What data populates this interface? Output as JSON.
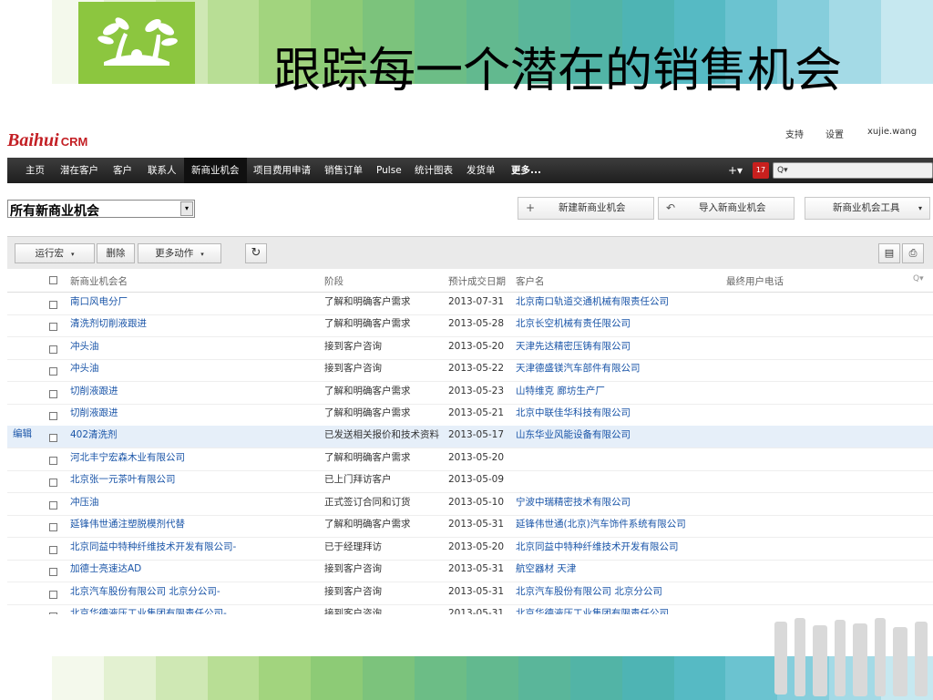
{
  "slide": {
    "title": "跟踪每一个潜在的销售机会",
    "colors": {
      "accent_green": "#8cc63f",
      "accent_teal": "#4fb8c4"
    }
  },
  "brand": {
    "name": "Baihui",
    "suffix": "CRM"
  },
  "util_links": {
    "support": "支持",
    "settings": "设置",
    "user": "xujie.wang"
  },
  "nav": {
    "items": [
      "主页",
      "潜在客户",
      "客户",
      "联系人",
      "新商业机会",
      "项目费用申请",
      "销售订单",
      "Pulse",
      "统计图表",
      "发货单",
      "更多..."
    ],
    "active": "新商业机会",
    "plus": "+▾",
    "calendar": "17",
    "search": "Q▾"
  },
  "view_select": {
    "value": "所有新商业机会",
    "arrow": "▾"
  },
  "actions": {
    "new": "新建新商业机会",
    "import": "导入新商业机会",
    "tools": "新商业机会工具",
    "tools_arrow": "▾"
  },
  "toolbar": {
    "run_macro": "运行宏",
    "delete": "删除",
    "more_actions": "更多动作",
    "dropdown": "▾",
    "refresh": "↻"
  },
  "columns": {
    "name": "新商业机会名",
    "stage": "阶段",
    "close_date": "预计成交日期",
    "account": "客户名",
    "last_phone": "最终用户电话",
    "search_icon": "Q▾"
  },
  "edit_label": "编辑",
  "rows": [
    {
      "name": "南口风电分厂",
      "stage": "了解和明确客户需求",
      "date": "2013-07-31",
      "account": "北京南口轨道交通机械有限责任公司"
    },
    {
      "name": "清洗剂切削液跟进",
      "stage": "了解和明确客户需求",
      "date": "2013-05-28",
      "account": "北京长空机械有责任限公司"
    },
    {
      "name": "冲头油",
      "stage": "接到客户咨询",
      "date": "2013-05-20",
      "account": "天津先达精密压铸有限公司"
    },
    {
      "name": "冲头油",
      "stage": "接到客户咨询",
      "date": "2013-05-22",
      "account": "天津德盛镁汽车部件有限公司"
    },
    {
      "name": "切削液跟进",
      "stage": "了解和明确客户需求",
      "date": "2013-05-23",
      "account": "山特维克  廊坊生产厂"
    },
    {
      "name": "切削液跟进",
      "stage": "了解和明确客户需求",
      "date": "2013-05-21",
      "account": "北京中联佳华科技有限公司"
    },
    {
      "name": "402清洗剂",
      "stage": "已发送相关报价和技术资料",
      "date": "2013-05-17",
      "account": "山东华业风能设备有限公司"
    },
    {
      "name": "河北丰宁宏森木业有限公司",
      "stage": "了解和明确客户需求",
      "date": "2013-05-20",
      "account": ""
    },
    {
      "name": "北京张一元茶叶有限公司",
      "stage": "已上门拜访客户",
      "date": "2013-05-09",
      "account": ""
    },
    {
      "name": "冲压油",
      "stage": "正式签订合同和订货",
      "date": "2013-05-10",
      "account": "宁波中瑞精密技术有限公司"
    },
    {
      "name": "延锋伟世通注塑脱模剂代替",
      "stage": "了解和明确客户需求",
      "date": "2013-05-31",
      "account": "延锋伟世通(北京)汽车饰件系统有限公司"
    },
    {
      "name": "北京同益中特种纤维技术开发有限公司-",
      "stage": "已于经理拜访",
      "date": "2013-05-20",
      "account": "北京同益中特种纤维技术开发有限公司"
    },
    {
      "name": "加德士亮速达AD",
      "stage": "接到客户咨询",
      "date": "2013-05-31",
      "account": "航空器材  天津"
    },
    {
      "name": "北京汽车股份有限公司  北京分公司-",
      "stage": "接到客户咨询",
      "date": "2013-05-31",
      "account": "北京汽车股份有限公司  北京分公司"
    },
    {
      "name": "北京华德液压工业集团有限责任公司-",
      "stage": "接到客户咨询",
      "date": "2013-05-31",
      "account": "北京华德液压工业集团有限责任公司"
    }
  ]
}
